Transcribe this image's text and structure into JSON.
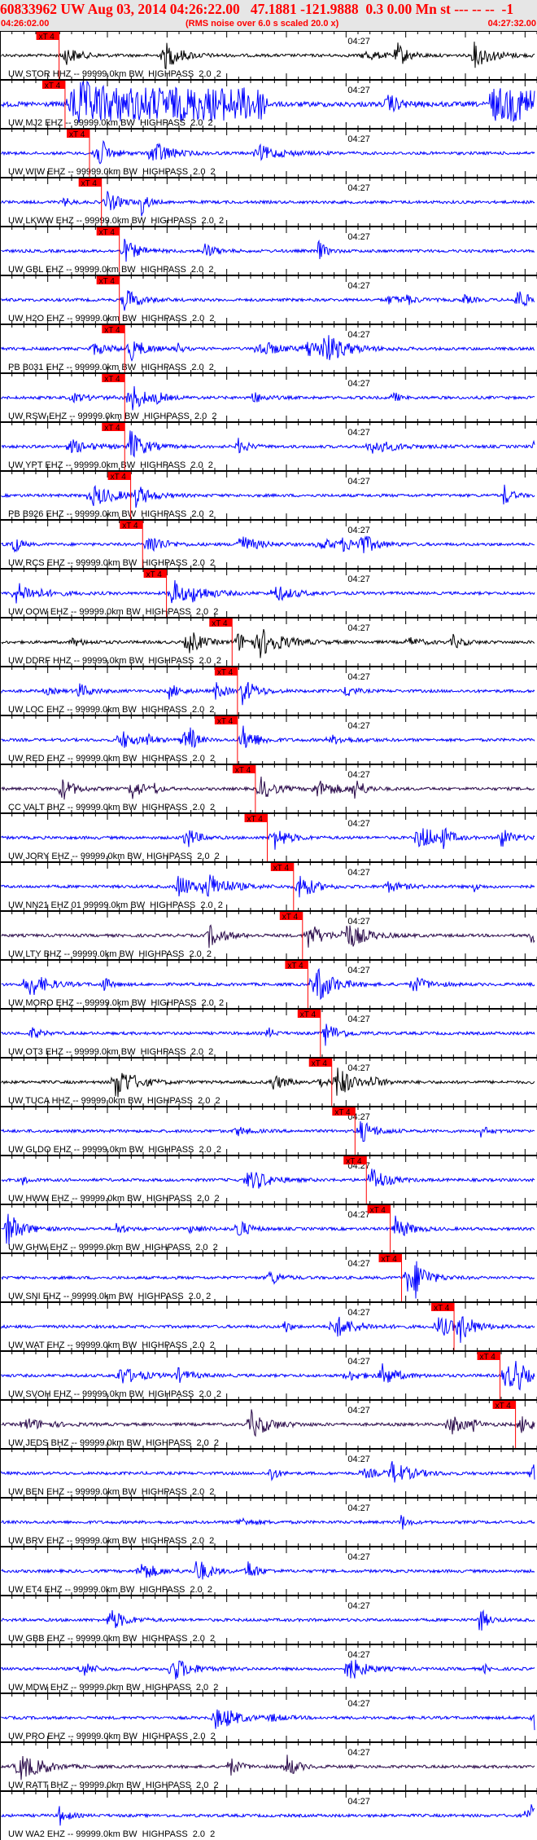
{
  "header": {
    "title": "60833962 UW Aug 03, 2014 04:26:22.00   47.1881 -121.9888  0.3 0.00 Mn st --- -- --  -1",
    "start_time": "04:26:02.00",
    "note": "(RMS noise over 6.0 s scaled 20.0 x)",
    "end_time": "04:27:32.00"
  },
  "time_axis": {
    "span_seconds": 90,
    "minute_label": "04:27",
    "minute_offset_seconds": 58
  },
  "pick_label": "xT 4",
  "colors": {
    "blue": "#0000ff",
    "black": "#000000",
    "purple": "#2a0a4a",
    "pick": "#ff0000",
    "header_bg": "#e6e6e6"
  },
  "traces": [
    {
      "label": "UW STOR HHZ -- 99999.0km BW  HIGHPASS  2.0  2",
      "color": "black",
      "pick": 9.9
    },
    {
      "label": "UW MJ2 EHZ -- 99999.0km BW  HIGHPASS  2.0  2",
      "color": "blue",
      "pick": 10.9,
      "loud": true
    },
    {
      "label": "UW WIW EHZ -- 99999.0km BW  HIGHPASS  2.0  2",
      "color": "blue",
      "pick": 15.0
    },
    {
      "label": "UW LKWW EHZ -- 99999.0km BW  HIGHPASS  2.0  2",
      "color": "blue",
      "pick": 17.0
    },
    {
      "label": "UW GBL EHZ -- 99999.0km BW  HIGHPASS  2.0  2",
      "color": "blue",
      "pick": 20.0
    },
    {
      "label": "UW H2O EHZ -- 99999.0km BW  HIGHPASS  2.0  2",
      "color": "blue",
      "pick": 20.0
    },
    {
      "label": "PB B031 EHZ -- 99999.0km BW  HIGHPASS  2.0  2",
      "color": "blue",
      "pick": 20.9
    },
    {
      "label": "UW RSW EHZ -- 99999.0km BW  HIGHPASS  2.0  2",
      "color": "blue",
      "pick": 20.9
    },
    {
      "label": "UW YPT EHZ -- 99999.0km BW  HIGHPASS  2.0  2",
      "color": "blue",
      "pick": 20.9
    },
    {
      "label": "PB B926 EHZ -- 99999.0km BW  HIGHPASS  2.0  2",
      "color": "blue",
      "pick": 21.9
    },
    {
      "label": "UW RCS EHZ -- 99999.0km BW  HIGHPASS  2.0  2",
      "color": "blue",
      "pick": 23.9
    },
    {
      "label": "UW OOW EHZ -- 99999.0km BW  HIGHPASS  2.0  2",
      "color": "blue",
      "pick": 27.9
    },
    {
      "label": "UW DDRF HHZ -- 99999.0km BW  HIGHPASS  2.0  2",
      "color": "black",
      "pick": 38.9
    },
    {
      "label": "UW LOC EHZ -- 99999.0km BW  HIGHPASS  2.0  2",
      "color": "blue",
      "pick": 39.8
    },
    {
      "label": "UW RED EHZ -- 99999.0km BW  HIGHPASS  2.0  2",
      "color": "blue",
      "pick": 39.8
    },
    {
      "label": "CC VALT BHZ -- 99999.0km BW  HIGHPASS  2.0  2",
      "color": "purple",
      "pick": 42.8
    },
    {
      "label": "UW JORY EHZ -- 99999.0km BW  HIGHPASS  2.0  2",
      "color": "blue",
      "pick": 44.8
    },
    {
      "label": "UW NN21 EHZ 01 99999.0km BW  HIGHPASS  2.0  2",
      "color": "blue",
      "pick": 49.2
    },
    {
      "label": "UW LTY BHZ -- 99999.0km BW  HIGHPASS  2.0  2",
      "color": "purple",
      "pick": 50.7
    },
    {
      "label": "UW MORO EHZ -- 99999.0km BW  HIGHPASS  2.0  2",
      "color": "blue",
      "pick": 51.6
    },
    {
      "label": "UW OT3 EHZ -- 99999.0km BW  HIGHPASS  2.0  2",
      "color": "blue",
      "pick": 53.7
    },
    {
      "label": "UW TUCA HHZ -- 99999.0km BW  HIGHPASS  2.0  2",
      "color": "black",
      "pick": 55.6
    },
    {
      "label": "UW GLDO EHZ -- 99999.0km BW  HIGHPASS  2.0  2",
      "color": "blue",
      "pick": 59.5
    },
    {
      "label": "UW HWW EHZ -- 99999.0km BW  HIGHPASS  2.0  2",
      "color": "blue",
      "pick": 61.4
    },
    {
      "label": "UW GHW EHZ -- 99999.0km BW  HIGHPASS  2.0  2",
      "color": "blue",
      "pick": 65.4
    },
    {
      "label": "UW SNI EHZ -- 99999.0km BW  HIGHPASS  2.0  2",
      "color": "blue",
      "pick": 67.3
    },
    {
      "label": "UW WAT EHZ -- 99999.0km BW  HIGHPASS  2.0  2",
      "color": "blue",
      "pick": 76.1
    },
    {
      "label": "UW SVOH EHZ -- 99999.0km BW  HIGHPASS  2.0  2",
      "color": "blue",
      "pick": 83.8
    },
    {
      "label": "UW JEDS BHZ -- 99999.0km BW  HIGHPASS  2.0  2",
      "color": "purple",
      "pick": 86.4
    },
    {
      "label": "UW BEN EHZ -- 99999.0km BW  HIGHPASS  2.0  2",
      "color": "blue"
    },
    {
      "label": "UW BRV EHZ -- 99999.0km BW  HIGHPASS  2.0  2",
      "color": "blue"
    },
    {
      "label": "UW ET4 EHZ -- 99999.0km BW  HIGHPASS  2.0  2",
      "color": "blue"
    },
    {
      "label": "UW GBB EHZ -- 99999.0km BW  HIGHPASS  2.0  2",
      "color": "blue"
    },
    {
      "label": "UW MDW EHZ -- 99999.0km BW  HIGHPASS  2.0  2",
      "color": "blue"
    },
    {
      "label": "UW PRO EHZ -- 99999.0km BW  HIGHPASS  2.0  2",
      "color": "blue"
    },
    {
      "label": "UW RATT BHZ -- 99999.0km BW  HIGHPASS  2.0  2",
      "color": "purple"
    },
    {
      "label": "UW WA2 EHZ -- 99999.0km BW  HIGHPASS  2.0  2",
      "color": "blue"
    }
  ]
}
